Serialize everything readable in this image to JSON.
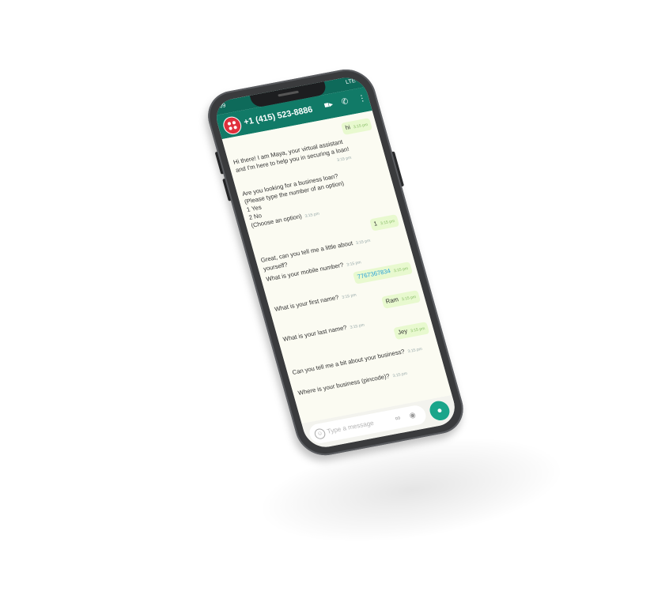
{
  "status_bar": {
    "time": "09",
    "right": "LTE"
  },
  "header": {
    "contact": "+1 (415) 523-8886",
    "video_icon": "video-icon",
    "call_icon": "phone-icon",
    "menu_icon": "more-vert-icon"
  },
  "messages": [
    {
      "dir": "out",
      "text": "hi",
      "time": "3:15 pm"
    },
    {
      "dir": "in",
      "lines": [
        "Hi there! I am Maya, your virtual assistant",
        "and I'm here to help you in securing a loan!"
      ],
      "time": "3:15 pm"
    },
    {
      "dir": "in",
      "lines": [
        "Are you looking for a business loan?",
        " (Please type the number of an option)",
        " 1  Yes",
        " 2  No",
        " (Choose an option)"
      ],
      "time": "3:15 pm"
    },
    {
      "dir": "out",
      "text": "1",
      "time": "3:15 pm"
    },
    {
      "dir": "in",
      "lines": [
        "Great, can you tell me a little about",
        "yourself?"
      ],
      "time": "3:15 pm"
    },
    {
      "dir": "in",
      "lines": [
        "What is your mobile number?"
      ],
      "time": "3:15 pm"
    },
    {
      "dir": "out",
      "text": "7767367834",
      "time": "3:15 pm"
    },
    {
      "dir": "in",
      "lines": [
        "What is your first name?"
      ],
      "time": "3:15 pm"
    },
    {
      "dir": "out",
      "text": "Ram",
      "time": "3:15 pm"
    },
    {
      "dir": "in",
      "lines": [
        "What is your last name?"
      ],
      "time": "3:15 pm"
    },
    {
      "dir": "out",
      "text": "Jey",
      "time": "3:15 pm"
    },
    {
      "dir": "in",
      "lines": [
        "Can you tell me a bit about your business?"
      ],
      "time": "3:15 pm"
    },
    {
      "dir": "in",
      "lines": [
        "Where is your business (pincode)?"
      ],
      "time": "3:15 pm"
    }
  ],
  "composer": {
    "placeholder": "Type a message",
    "emoji_icon": "emoji-icon",
    "attach_icon": "paperclip-icon",
    "camera_icon": "camera-icon",
    "mic_icon": "mic-icon"
  },
  "colors": {
    "header": "#117a67",
    "status": "#0e6a5a",
    "outgoing": "#e8f9cf",
    "chat_bg": "#fbfbf2",
    "mic": "#1aa58a",
    "link": "#25a0d8"
  }
}
